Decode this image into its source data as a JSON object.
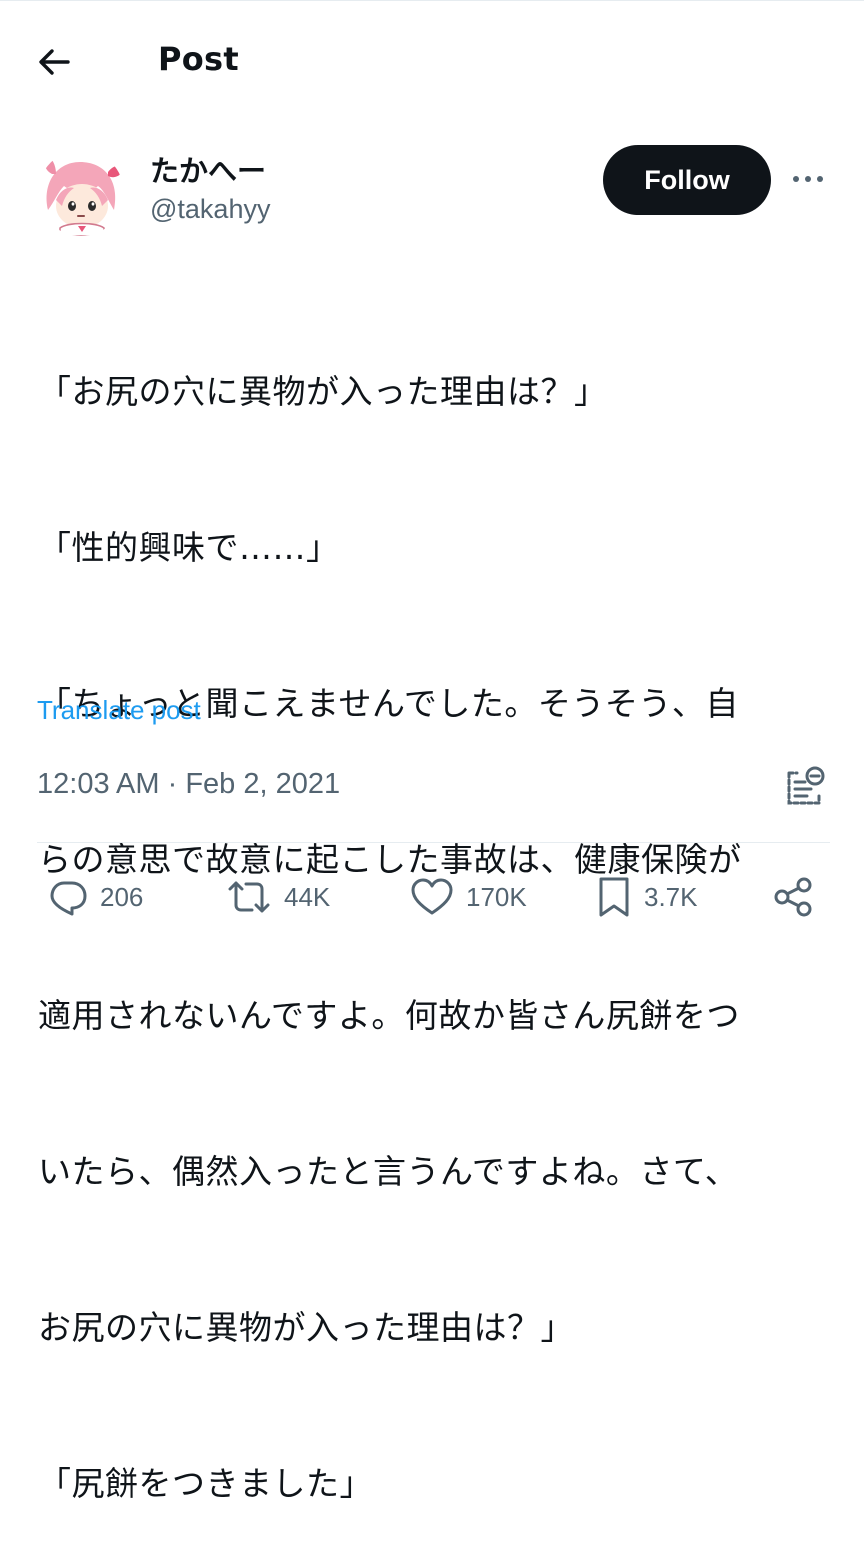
{
  "header": {
    "title": "Post"
  },
  "author": {
    "display_name": "たかへー",
    "handle": "@takahyy",
    "follow_label": "Follow"
  },
  "post": {
    "lines": [
      "「お尻の穴に異物が入った理由は？」",
      "「性的興味で……」",
      "「ちょっと聞こえませんでした。そうそう、自",
      "らの意思で故意に起こした事故は、健康保険が",
      "適用されないんですよ。何故か皆さん尻餅をつ",
      "いたら、偶然入ったと言うんですよね。さて、",
      "お尻の穴に異物が入った理由は？」",
      "「尻餅をつきました」"
    ],
    "translate_label": "Translate post",
    "time": "12:03 AM",
    "separator": " · ",
    "date": "Feb 2, 2021"
  },
  "actions": {
    "replies": "206",
    "reposts": "44K",
    "likes": "170K",
    "bookmarks": "3.7K"
  },
  "colors": {
    "text": "#0f1419",
    "secondary": "#536471",
    "link": "#1d9bf0",
    "follow_bg": "#0f1419"
  },
  "icons": [
    "back-arrow-icon",
    "more-icon",
    "notes-icon",
    "reply-icon",
    "repost-icon",
    "like-icon",
    "bookmark-icon",
    "share-icon"
  ]
}
